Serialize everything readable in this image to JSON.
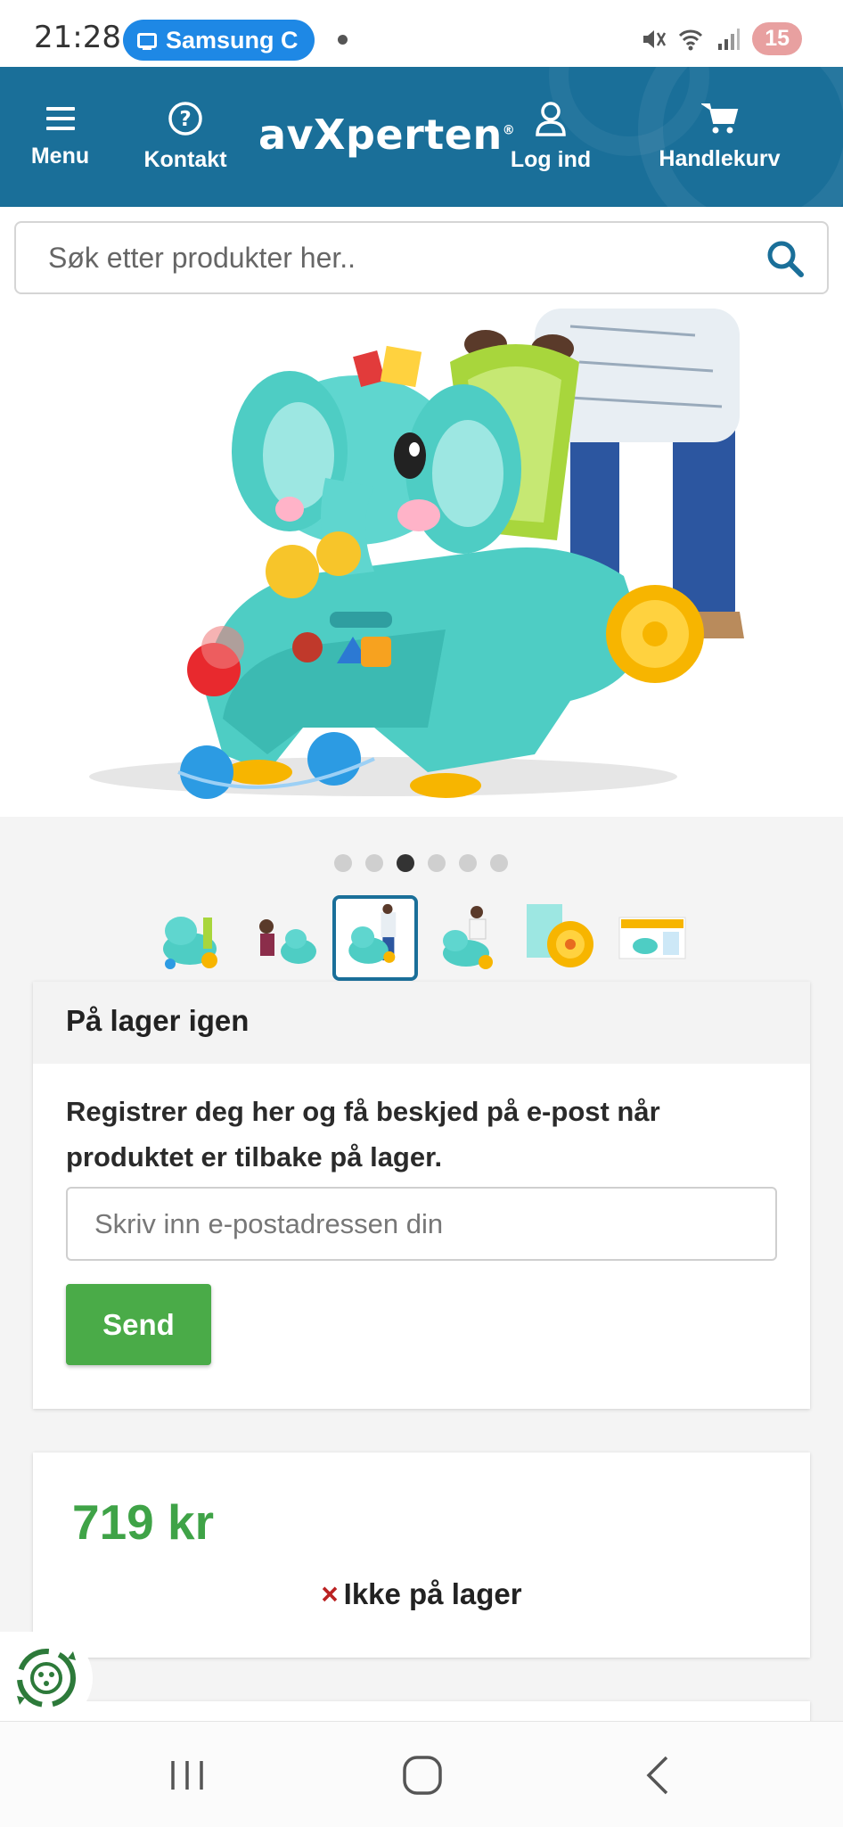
{
  "status_bar": {
    "time": "21:28",
    "notification_pill": "Samsung C",
    "notification_badge": "15",
    "icons": [
      "mute-icon",
      "wifi-icon",
      "signal-icon"
    ]
  },
  "header": {
    "menu_label": "Menu",
    "contact_label": "Kontakt",
    "logo_text": "avXperten",
    "logo_mark": "®",
    "login_label": "Log ind",
    "cart_label": "Handlekurv",
    "bg_color": "#1a6f99"
  },
  "search": {
    "placeholder": "Søk etter produkter her.."
  },
  "gallery": {
    "total_images": 6,
    "active_index": 3
  },
  "restock": {
    "title": "På lager igen",
    "description": "Registrer deg her og få beskjed på e-post når produktet er tilbake på lager.",
    "email_placeholder": "Skriv inn e-postadressen din",
    "send_label": "Send"
  },
  "price_box": {
    "price": "719 kr",
    "stock_icon": "×",
    "stock_status": "Ikke på lager",
    "price_color": "#3fa347"
  }
}
